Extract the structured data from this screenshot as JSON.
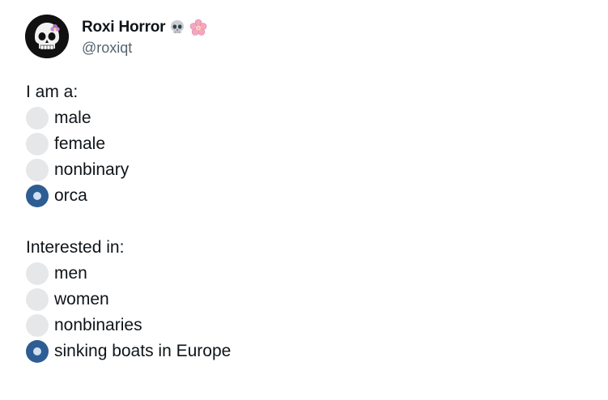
{
  "author": {
    "display_name": "Roxi Horror",
    "handle": "@roxiqt",
    "emojis": [
      "skull-emoji",
      "cherry-blossom-emoji"
    ],
    "avatar": "skull-avatar"
  },
  "sections": [
    {
      "title": "I am a:",
      "options": [
        {
          "label": "male",
          "checked": false
        },
        {
          "label": "female",
          "checked": false
        },
        {
          "label": "nonbinary",
          "checked": false
        },
        {
          "label": "orca",
          "checked": true
        }
      ]
    },
    {
      "title": "Interested in:",
      "options": [
        {
          "label": "men",
          "checked": false
        },
        {
          "label": "women",
          "checked": false
        },
        {
          "label": "nonbinaries",
          "checked": false
        },
        {
          "label": "sinking boats in Europe",
          "checked": true
        }
      ]
    }
  ],
  "colors": {
    "radio_unchecked": "#e6e7e9",
    "radio_checked": "#2d5d92",
    "radio_dot": "#cfe0f3",
    "handle_text": "#536471",
    "main_text": "#0f1419"
  }
}
